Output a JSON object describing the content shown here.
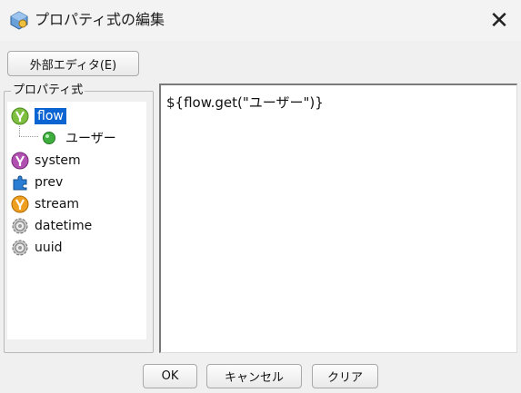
{
  "window": {
    "title": "プロパティ式の編集",
    "close_glyph": "✕"
  },
  "toolbar": {
    "external_editor_label": "外部エディタ(E)"
  },
  "tree": {
    "legend": "プロパティ式",
    "items": [
      {
        "label": "flow",
        "icon": "flow-icon",
        "selected": true
      },
      {
        "label": "ユーザー",
        "icon": "green-ball-icon",
        "selected": false
      },
      {
        "label": "system",
        "icon": "system-icon",
        "selected": false
      },
      {
        "label": "prev",
        "icon": "puzzle-icon",
        "selected": false
      },
      {
        "label": "stream",
        "icon": "stream-icon",
        "selected": false
      },
      {
        "label": "datetime",
        "icon": "gear-icon",
        "selected": false
      },
      {
        "label": "uuid",
        "icon": "gear-icon",
        "selected": false
      }
    ]
  },
  "editor": {
    "value": "${flow.get(\"ユーザー\")}"
  },
  "buttons": {
    "ok_label": "OK",
    "cancel_label": "キャンセル",
    "clear_label": "クリア"
  },
  "colors": {
    "selection": "#0a64d2",
    "flow_icon": "#7fbf3f",
    "system_icon": "#b050b0",
    "stream_icon": "#f0a020",
    "puzzle_icon": "#2a7fd4"
  }
}
